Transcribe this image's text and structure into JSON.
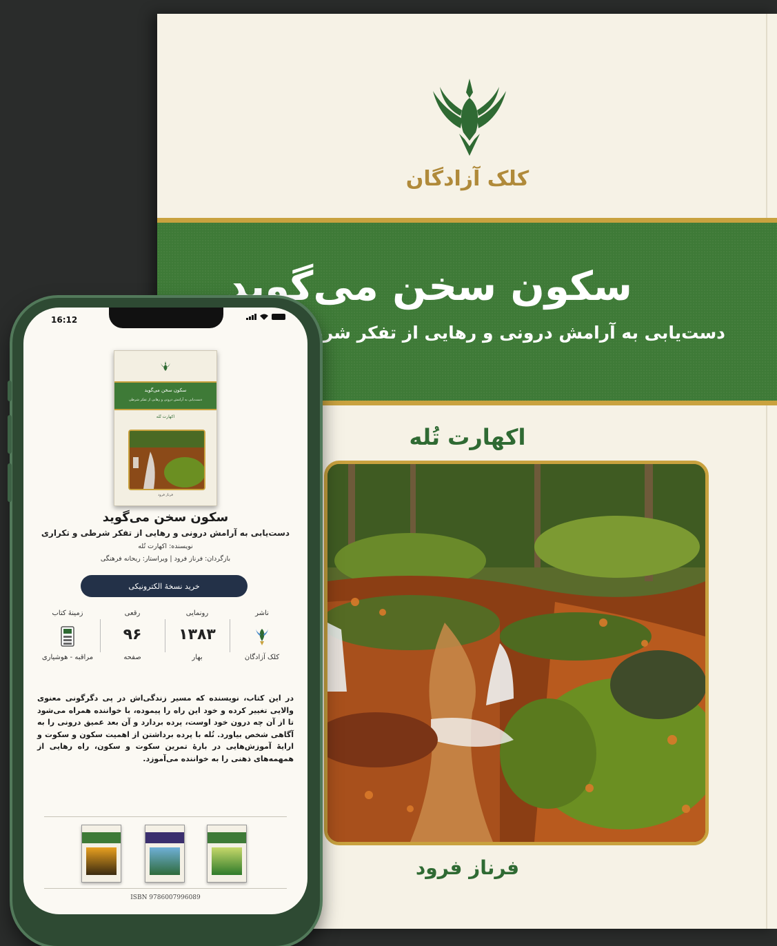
{
  "cover": {
    "publisher": "کلک آزادگان",
    "title": "سکون سخن می‌گوید",
    "subtitle": "دست‌یابی به آرامش درونی و رهایی از تفکر شرطی",
    "author": "اکهارت تُله",
    "translator": "فرناز فرود"
  },
  "phone": {
    "status_time": "16:12",
    "book_title": "سکون سخن می‌گوید",
    "book_subtitle": "دست‌یابی به آرامش درونی و رهایی از تفکر شرطی و تکراری",
    "author_line": "نویسنده: اکهارت تُله",
    "credits_line": "بازگردان: فرناز فرود | ویراستار: ریحانه فرهنگی",
    "buy_button": "خرید نسخهٔ الکترونیکی",
    "info": {
      "publisher_label": "ناشر",
      "publisher_value": "کلک آزادگان",
      "release_label": "رونمایی",
      "release_value": "۱۳۸۳",
      "release_season": "بهار",
      "pages_label": "رقعی",
      "pages_value": "۹۶",
      "pages_unit": "صفحه",
      "category_label": "زمینهٔ کتاب",
      "category_value": "مراقبه - هوشیاری"
    },
    "description": "در این کتاب، نویسنده که مسیر زندگی‌اش در پی دگرگونی معنوی والایی تغییر کرده و خود این راه را پیموده، با خواننده همراه می‌شود تا از آن چه درون خود اوست، پرده بردارد و آن بعد عمیق درونی را به آگاهی شخص بیاورد. تُله با پرده برداشتن از اهمیت سکون و سکوت و ارایهٔ آموزش‌هایی در بارهٔ تمرین سکوت و سکون، راه رهایی از همهمه‌های ذهنی را به خواننده می‌آموزد.",
    "isbn": "ISBN 9786007996089"
  },
  "colors": {
    "accent_green": "#3e7a37",
    "gold": "#c9a23f",
    "button_navy": "#233148"
  }
}
